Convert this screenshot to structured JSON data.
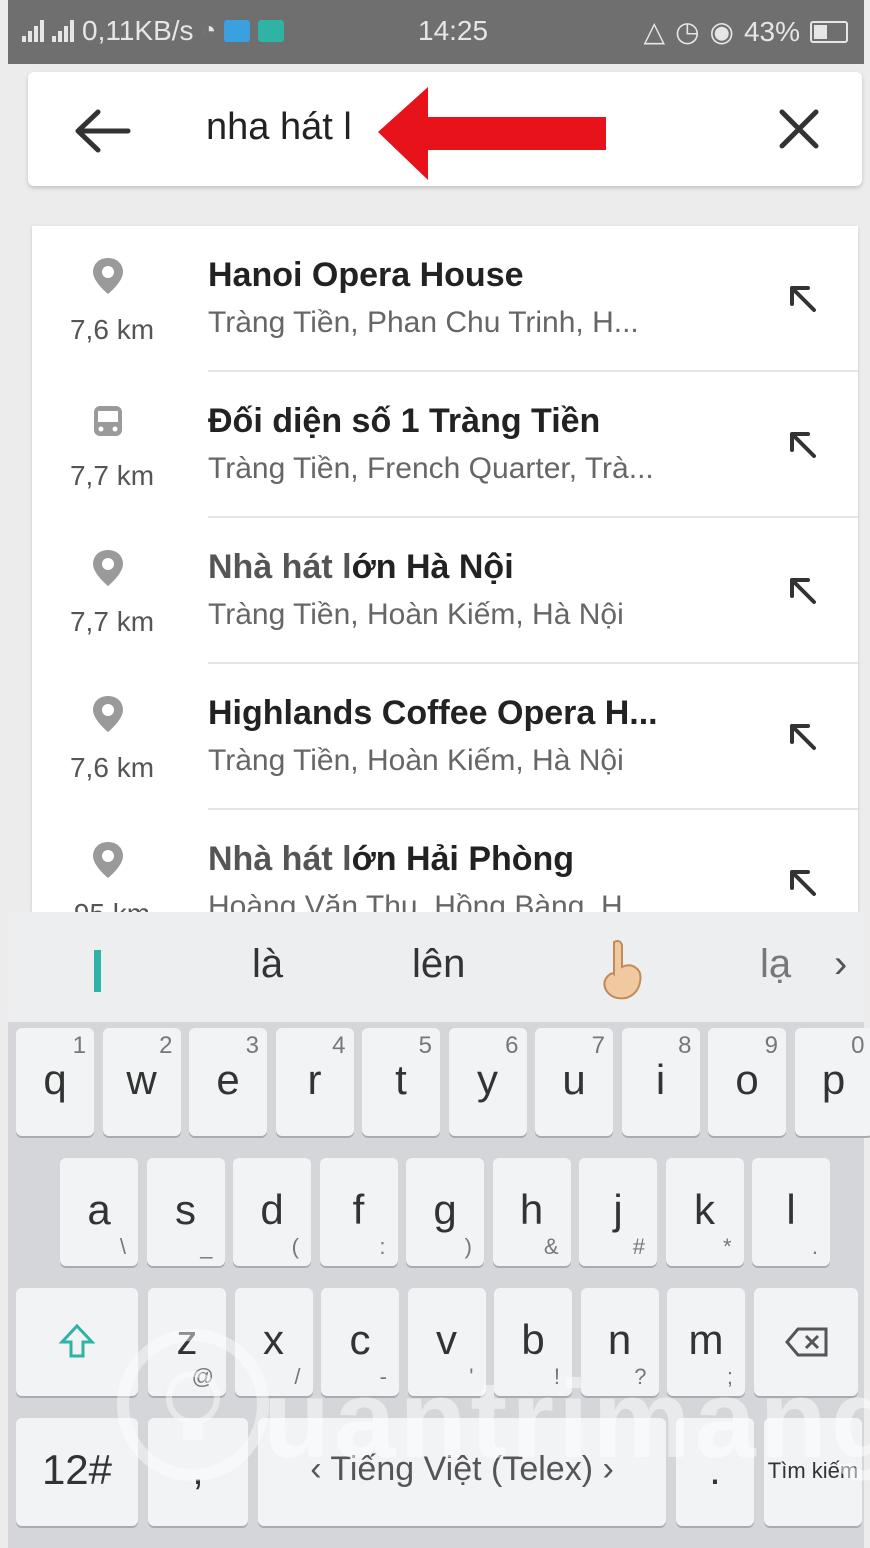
{
  "status_bar": {
    "speed": "0,11KB/s",
    "time": "14:25",
    "battery": "43%"
  },
  "search": {
    "query": "nha hát l"
  },
  "results": [
    {
      "icon": "location-pin-icon",
      "distance": "7,6 km",
      "title_dim": "",
      "title_bold": "Hanoi Opera House",
      "subtitle": "Tràng Tiền, Phan Chu Trinh, H..."
    },
    {
      "icon": "bus-icon",
      "distance": "7,7 km",
      "title_dim": "",
      "title_bold": "Đối diện số 1 Tràng Tiền",
      "subtitle": "Tràng Tiền, French Quarter, Trà..."
    },
    {
      "icon": "location-pin-icon",
      "distance": "7,7 km",
      "title_dim": "Nhà hát l",
      "title_bold": "ớn Hà Nội",
      "subtitle": "Tràng Tiền, Hoàn Kiếm, Hà Nội"
    },
    {
      "icon": "location-pin-icon",
      "distance": "7,6 km",
      "title_dim": "",
      "title_bold": "Highlands Coffee Opera H...",
      "subtitle": "Tràng Tiền, Hoàn Kiếm, Hà Nội"
    },
    {
      "icon": "location-pin-icon",
      "distance": "95 km",
      "title_dim": "Nhà hát l",
      "title_bold": "ớn Hải Phòng",
      "subtitle": "Hoàng Văn Thụ, Hồng Bàng, H..."
    }
  ],
  "keyboard": {
    "suggestions": [
      "là",
      "lên",
      "lạ"
    ],
    "row1": [
      {
        "k": "q",
        "h": "1"
      },
      {
        "k": "w",
        "h": "2"
      },
      {
        "k": "e",
        "h": "3"
      },
      {
        "k": "r",
        "h": "4"
      },
      {
        "k": "t",
        "h": "5"
      },
      {
        "k": "y",
        "h": "6"
      },
      {
        "k": "u",
        "h": "7"
      },
      {
        "k": "i",
        "h": "8"
      },
      {
        "k": "o",
        "h": "9"
      },
      {
        "k": "p",
        "h": "0"
      }
    ],
    "row2": [
      {
        "k": "a",
        "s": "\\"
      },
      {
        "k": "s",
        "s": "_"
      },
      {
        "k": "d",
        "s": "("
      },
      {
        "k": "f",
        "s": ":"
      },
      {
        "k": "g",
        "s": ")"
      },
      {
        "k": "h",
        "s": "&"
      },
      {
        "k": "j",
        "s": "#"
      },
      {
        "k": "k",
        "s": "*"
      },
      {
        "k": "l",
        "s": "."
      }
    ],
    "row3": [
      {
        "k": "z",
        "s": "@"
      },
      {
        "k": "x",
        "s": "/"
      },
      {
        "k": "c",
        "s": "-"
      },
      {
        "k": "v",
        "s": "'"
      },
      {
        "k": "b",
        "s": "!"
      },
      {
        "k": "n",
        "s": "?"
      },
      {
        "k": "m",
        "s": ";"
      }
    ],
    "numbers_key": "12#",
    "comma_key": ",",
    "space_label": "Tiếng Việt (Telex)",
    "period_key": ".",
    "search_key": "Tìm kiếm"
  },
  "watermark": "uantrimang",
  "colors": {
    "accent": "#2fb3a4",
    "arrow": "#e8121b"
  }
}
